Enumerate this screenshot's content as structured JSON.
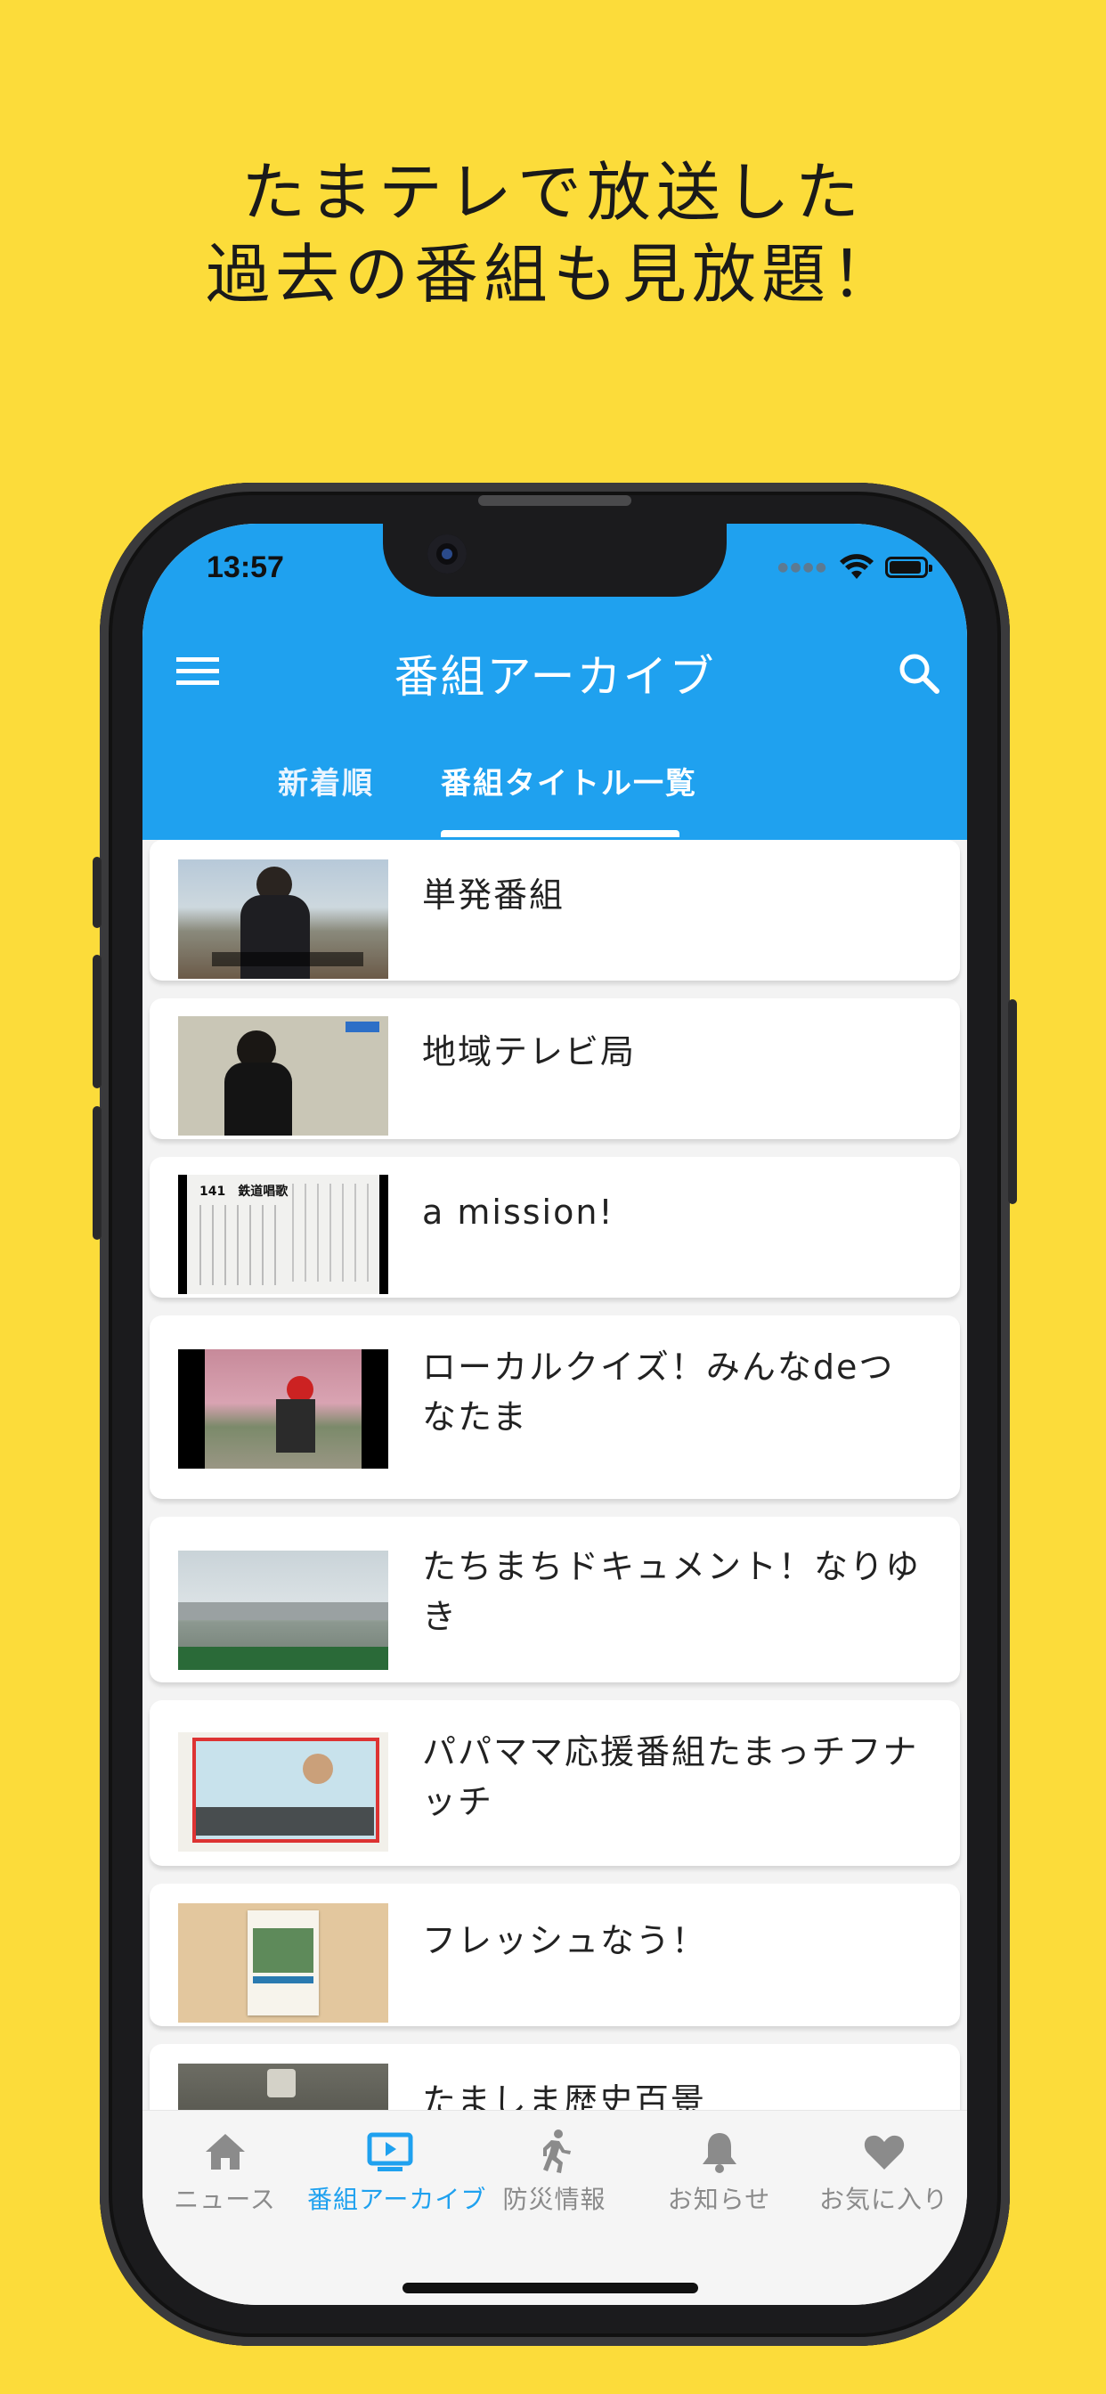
{
  "headline": [
    "たまテレで放送した",
    "過去の番組も見放題！"
  ],
  "status_bar": {
    "time": "13:57"
  },
  "appbar": {
    "title": "番組アーカイブ"
  },
  "tabs": [
    {
      "label": "新着順",
      "active": false
    },
    {
      "label": "番組タイトル一覧",
      "active": true
    }
  ],
  "programs": [
    {
      "title": "単発番組"
    },
    {
      "title": "地域テレビ局"
    },
    {
      "title": "a mission!",
      "thumb_text": "141　鉄道唱歌"
    },
    {
      "title": "ローカルクイズ！みんなdeつなたま"
    },
    {
      "title": "たちまちドキュメント！なりゆき"
    },
    {
      "title": "パパママ応援番組たまっチフナッチ"
    },
    {
      "title": "フレッシュなう！"
    },
    {
      "title": "たましま歴史百景"
    }
  ],
  "bottom_nav": [
    {
      "label": "ニュース",
      "icon": "home-icon",
      "active": false
    },
    {
      "label": "番組アーカイブ",
      "icon": "tv-play-icon",
      "active": true
    },
    {
      "label": "防災情報",
      "icon": "running-person-icon",
      "active": false
    },
    {
      "label": "お知らせ",
      "icon": "bell-icon",
      "active": false
    },
    {
      "label": "お気に入り",
      "icon": "heart-icon",
      "active": false
    }
  ],
  "colors": {
    "background": "#FCDC3A",
    "accent": "#1FA1EF"
  }
}
